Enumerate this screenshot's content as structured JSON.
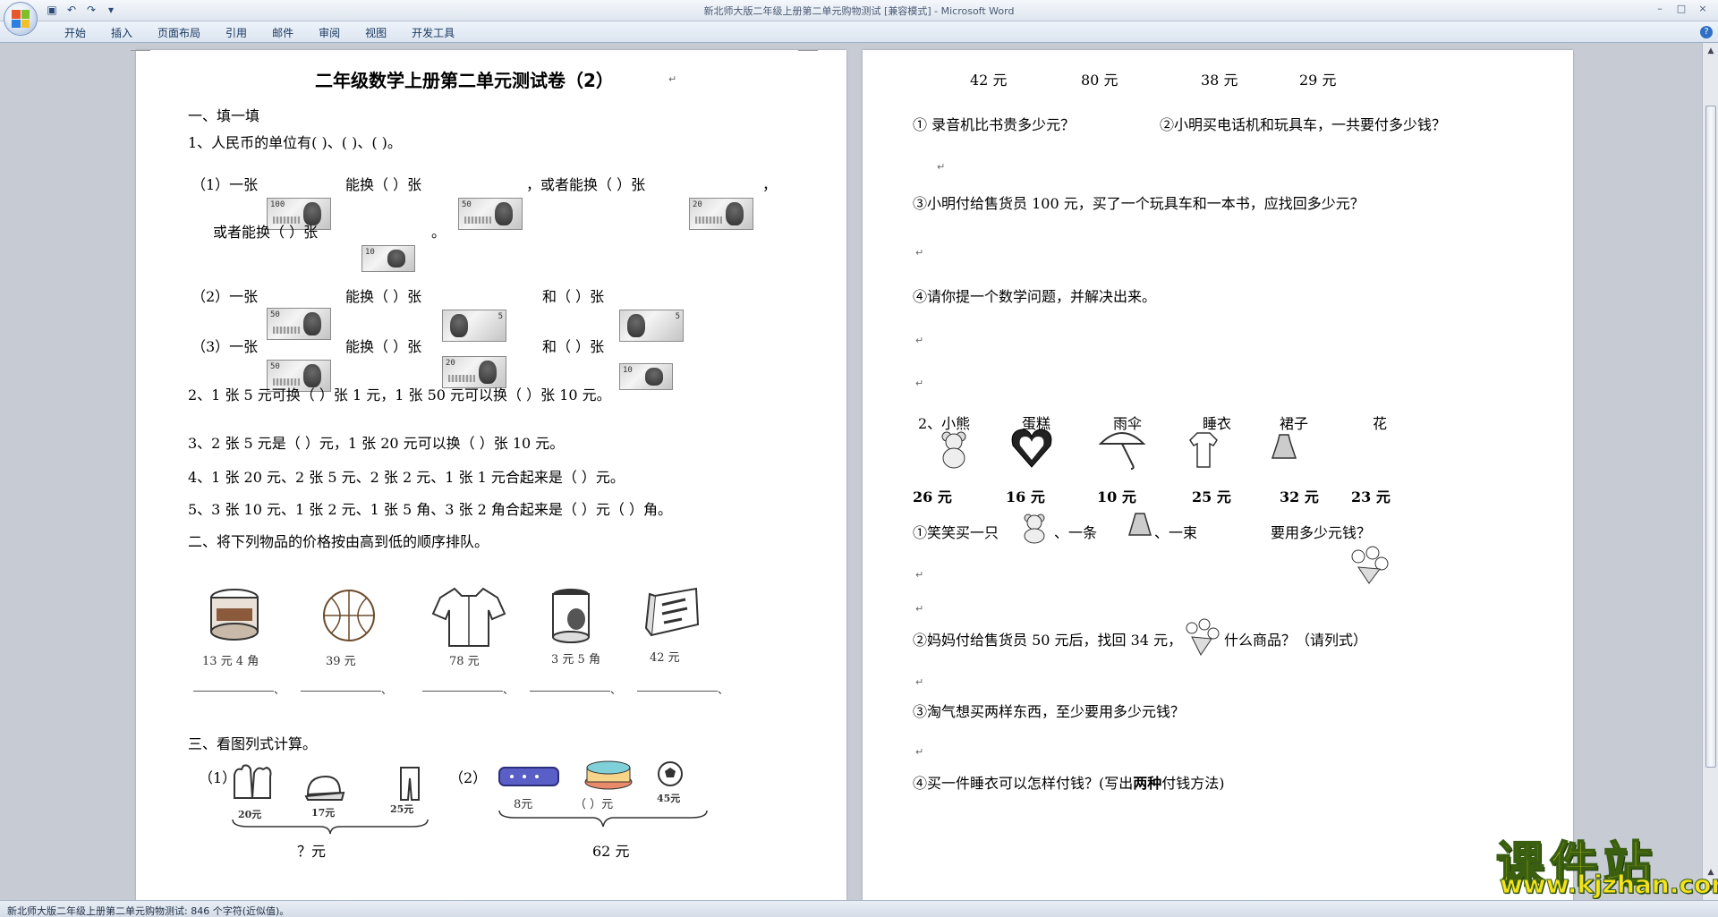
{
  "window": {
    "title": "新北师大版二年级上册第二单元购物测试 [兼容模式] - Microsoft Word",
    "min": "–",
    "max": "□",
    "close": "×"
  },
  "ribbon": {
    "tabs": [
      "开始",
      "插入",
      "页面布局",
      "引用",
      "邮件",
      "审阅",
      "视图",
      "开发工具"
    ],
    "help": "?"
  },
  "status": {
    "text": "新北师大版二年级上册第二单元购物测试: 846 个字符(近似值)。"
  },
  "watermark": {
    "main": "课件站",
    "url": "www.kjzhan.com"
  },
  "left_page": {
    "title": "二年级数学上册第二单元测试卷（2）",
    "sec1": "一、填一填",
    "q1": "1、人民币的单位有(       )、(         )、(         )。",
    "q1_1a": "（1）一张",
    "q1_1b": "能换（    ）张",
    "q1_1c": "，或者能换（    ）张",
    "q1_1d": "，",
    "q1_1e": "或者能换（    ）张",
    "q1_1f": "。",
    "q1_2a": "（2）一张",
    "q1_2b": "能换（         ）张",
    "q1_2c": "和（         ）张",
    "q1_3a": "（3）一张",
    "q1_3b": "能换（         ）张",
    "q1_3c": "和（         ）张",
    "q2": "2、1 张 5 元可换（    ）张 1 元，1 张 50 元可以换（    ）张 10 元。",
    "q3": "3、2 张 5 元是（      ）元，1 张 20 元可以换（        ）张 10 元。",
    "q4": "4、1 张 20 元、2 张 5 元、2 张 2 元、1 张 1 元合起来是（    ）元。",
    "q5": "5、3 张 10 元、1 张 2 元、1 张 5 角、3 张 2 角合起来是（    ）元（     ）角。",
    "sec2": "二、将下列物品的价格按由高到低的顺序排队。",
    "items": [
      {
        "name": "can-icon",
        "price": "13 元 4 角"
      },
      {
        "name": "basketball-icon",
        "price": "39 元"
      },
      {
        "name": "shirt-icon",
        "price": "78 元"
      },
      {
        "name": "jar-icon",
        "price": "3 元 5 角"
      },
      {
        "name": "box-icon",
        "price": "42 元"
      }
    ],
    "sep": "、",
    "sec3": "三、看图列式计算。",
    "p1_label": "（1）",
    "p1_prices": [
      "20元",
      "17元",
      "25元"
    ],
    "p1_total": "？元",
    "p2_label": "（2）",
    "p2_prices": [
      "8元",
      "（    ）元",
      "45元"
    ],
    "p2_total": "62 元"
  },
  "right_page": {
    "prices_row": [
      "42 元",
      "80 元",
      "38 元",
      "29 元"
    ],
    "r1a": "① 录音机比书贵多少元？",
    "r1b": "②小明买电话机和玩具车，一共要付多少钱？",
    "r3": "③小明付给售货员 100 元，买了一个玩具车和一本书，应找回多少元？",
    "r4": "④请你提一个数学问题，并解决出来。",
    "s2_items": [
      "2、小熊",
      "蛋糕",
      "雨伞",
      "睡衣",
      "裙子",
      "花"
    ],
    "s2_prices": [
      "26 元",
      "16 元",
      "10 元",
      "25 元",
      "32 元",
      "23 元"
    ],
    "q1a": "①笑笑买一只",
    "q1b": "、一条",
    "q1c": "、一束",
    "q1d": "要用多少元钱？",
    "q2a": "②妈妈付给售货员 50 元后，找回 34 元，",
    "q2b": "什么商品？（请列式）",
    "q3": "③淘气想买两样东西，至少要用多少元钱？",
    "q4a": "④买一件睡衣可以怎样付钱？(写出",
    "q4b": "两种",
    "q4c": "付钱方法)"
  },
  "notes": {
    "n100": "100",
    "n50": "50",
    "n20": "20",
    "n10": "10",
    "n5": "5"
  }
}
